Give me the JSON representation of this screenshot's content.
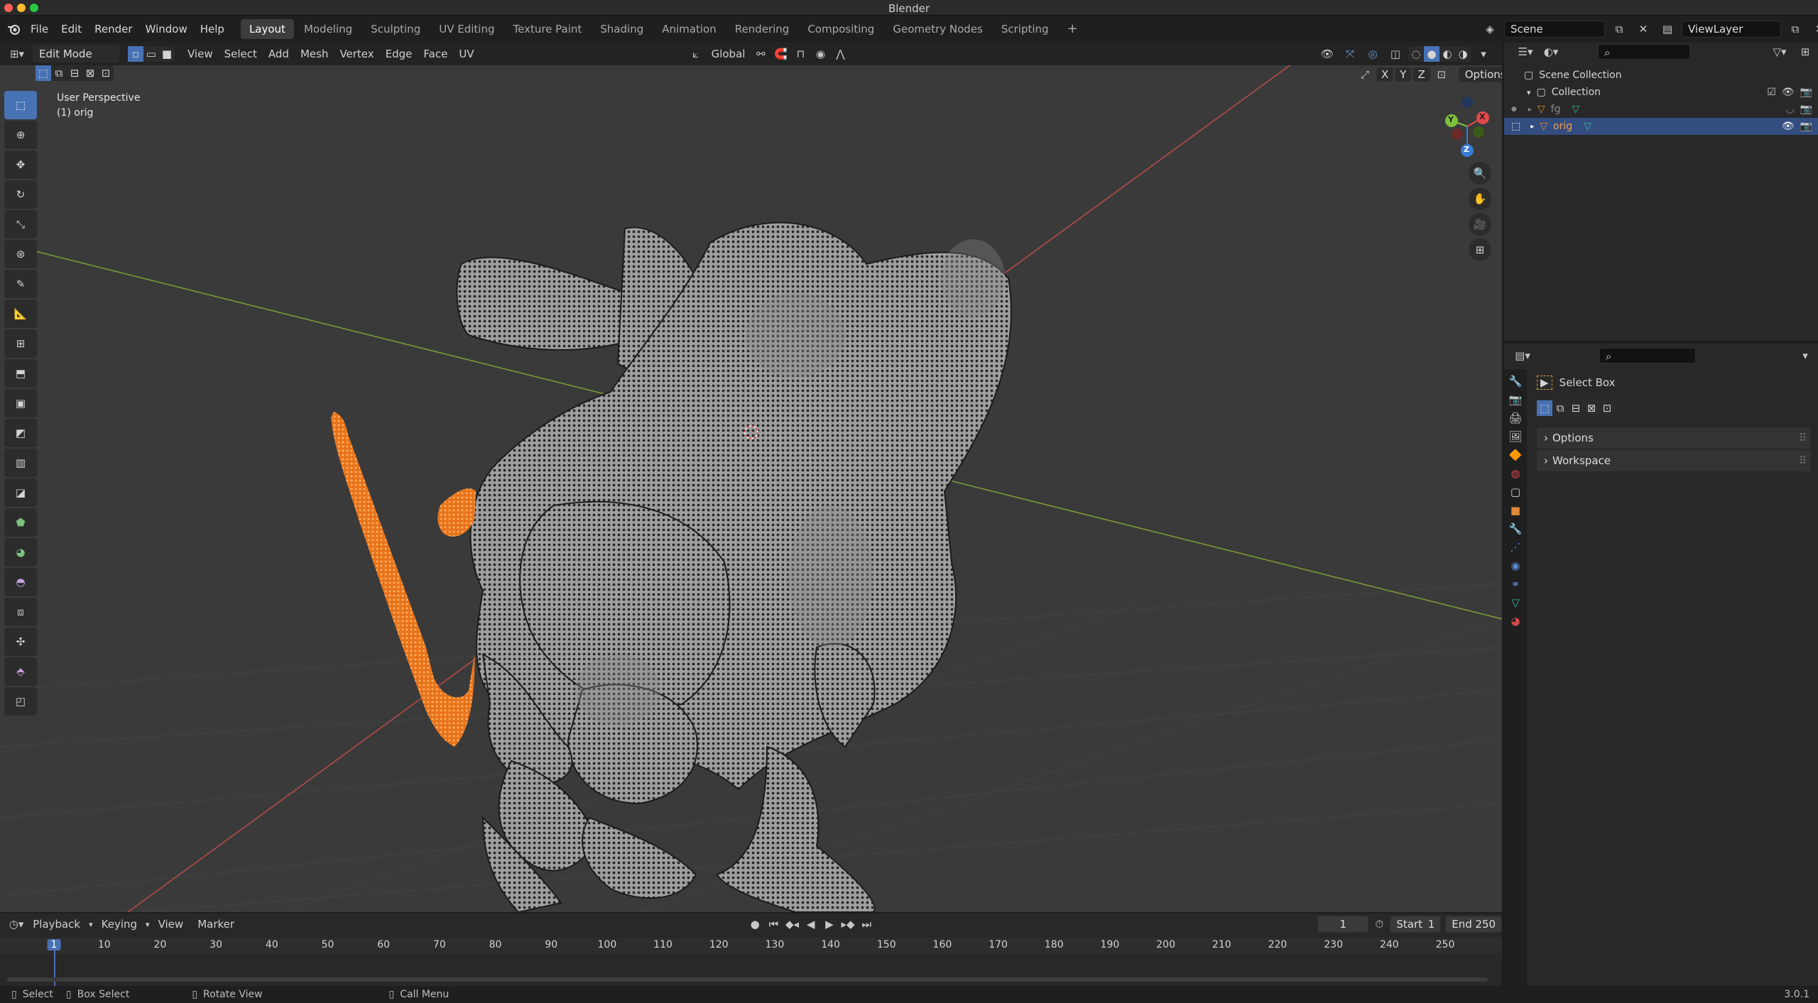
{
  "window": {
    "title": "Blender"
  },
  "menu": {
    "file": "File",
    "edit": "Edit",
    "render": "Render",
    "window": "Window",
    "help": "Help"
  },
  "workspaces": [
    "Layout",
    "Modeling",
    "Sculpting",
    "UV Editing",
    "Texture Paint",
    "Shading",
    "Animation",
    "Rendering",
    "Compositing",
    "Geometry Nodes",
    "Scripting"
  ],
  "scene": {
    "name": "Scene",
    "view_layer": "ViewLayer"
  },
  "viewport_header": {
    "mode": "Edit Mode",
    "view": "View",
    "select": "Select",
    "add": "Add",
    "mesh": "Mesh",
    "vertex": "Vertex",
    "edge": "Edge",
    "face": "Face",
    "uv": "UV",
    "orientation": "Global",
    "options": "Options",
    "axis_x": "X",
    "axis_y": "Y",
    "axis_z": "Z"
  },
  "viewport": {
    "perspective": "User Perspective",
    "object": "(1) orig"
  },
  "gizmo": {
    "x": "X",
    "y": "Y",
    "z": "Z"
  },
  "outliner": {
    "root": "Scene Collection",
    "collection": "Collection",
    "objects": [
      {
        "name": "fg"
      },
      {
        "name": "orig"
      }
    ]
  },
  "properties": {
    "tool_name": "Select Box",
    "panels": [
      "Options",
      "Workspace"
    ]
  },
  "timeline": {
    "playback": "Playback",
    "keying": "Keying",
    "view": "View",
    "marker": "Marker",
    "current_frame": "1",
    "start_label": "Start",
    "start": "1",
    "end_label": "End",
    "end": "250",
    "ticks": [
      "1",
      "10",
      "20",
      "30",
      "40",
      "50",
      "60",
      "70",
      "80",
      "90",
      "100",
      "110",
      "120",
      "130",
      "140",
      "150",
      "160",
      "170",
      "180",
      "190",
      "200",
      "210",
      "220",
      "230",
      "240",
      "250"
    ]
  },
  "status": {
    "select": "Select",
    "box_select": "Box Select",
    "rotate_view": "Rotate View",
    "call_menu": "Call Menu",
    "version": "3.0.1"
  },
  "colors": {
    "accent": "#4772b3",
    "selected_vertices": "#f08a24",
    "axis_x": "#b54a4a",
    "axis_y": "#7a9a3a",
    "mesh": "#b9b9b9"
  }
}
